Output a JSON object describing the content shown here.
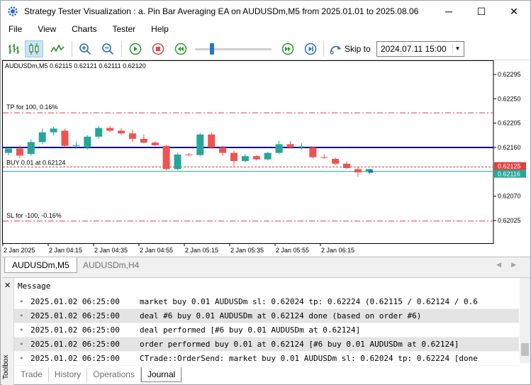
{
  "window": {
    "title": "Strategy Tester Visualization : a. Pin Bar Averaging EA on AUDUSDm,M5 from 2025.01.01 to 2025.08.06",
    "minimize_glyph": "─",
    "maximize_glyph": "☐",
    "close_glyph": "✕"
  },
  "menu": [
    "File",
    "View",
    "Charts",
    "Tester",
    "Help"
  ],
  "toolbar": {
    "skip_label": "Skip to",
    "skip_value": "2024.07.11 15:00",
    "slider_fraction": 0.22
  },
  "chart": {
    "info": "AUDUSDm,M5  0.62115 0.62121 0.62111 0.62120",
    "tp_label": "TP for 100, 0.16%",
    "buy_label": "BUY 0.01 at 0.62124",
    "sl_label": "SL for -100, -0.16%",
    "price_ticks": [
      "0.62295",
      "0.62250",
      "0.62205",
      "0.62160",
      "0.62070",
      "0.62025"
    ],
    "badge_red": "0.62125",
    "badge_green": "0.62116",
    "time_ticks": [
      "2 Jan 2025",
      "2 Jan 04:15",
      "2 Jan 04:35",
      "2 Jan 04:55",
      "2 Jan 05:15",
      "2 Jan 05:35",
      "2 Jan 05:55",
      "2 Jan 06:15"
    ],
    "colors": {
      "up": "#26a69a",
      "down": "#ef5350",
      "buy_line": "#00008b",
      "stop_line": "#e04040",
      "bid_line": "#26a69a"
    },
    "candles": [
      {
        "o": 0.6215,
        "h": 0.6216,
        "l": 0.62145,
        "c": 0.62158
      },
      {
        "o": 0.62158,
        "h": 0.62164,
        "l": 0.6214,
        "c": 0.62145
      },
      {
        "o": 0.62148,
        "h": 0.62175,
        "l": 0.62145,
        "c": 0.6217
      },
      {
        "o": 0.6217,
        "h": 0.62195,
        "l": 0.62166,
        "c": 0.62188
      },
      {
        "o": 0.62188,
        "h": 0.62198,
        "l": 0.62182,
        "c": 0.62195
      },
      {
        "o": 0.62191,
        "h": 0.62195,
        "l": 0.6216,
        "c": 0.62163
      },
      {
        "o": 0.62163,
        "h": 0.62171,
        "l": 0.62158,
        "c": 0.62164
      },
      {
        "o": 0.6216,
        "h": 0.62183,
        "l": 0.62156,
        "c": 0.6218
      },
      {
        "o": 0.6218,
        "h": 0.622,
        "l": 0.62176,
        "c": 0.62196
      },
      {
        "o": 0.62196,
        "h": 0.622,
        "l": 0.62188,
        "c": 0.62191
      },
      {
        "o": 0.62191,
        "h": 0.62196,
        "l": 0.62183,
        "c": 0.62186
      },
      {
        "o": 0.62186,
        "h": 0.62193,
        "l": 0.6217,
        "c": 0.62176
      },
      {
        "o": 0.62176,
        "h": 0.62184,
        "l": 0.62168,
        "c": 0.62169
      },
      {
        "o": 0.62169,
        "h": 0.62172,
        "l": 0.62163,
        "c": 0.62164
      },
      {
        "o": 0.62163,
        "h": 0.62165,
        "l": 0.62118,
        "c": 0.6212
      },
      {
        "o": 0.6212,
        "h": 0.6215,
        "l": 0.62118,
        "c": 0.62147
      },
      {
        "o": 0.62147,
        "h": 0.6215,
        "l": 0.62144,
        "c": 0.62146
      },
      {
        "o": 0.62146,
        "h": 0.62186,
        "l": 0.62144,
        "c": 0.62184
      },
      {
        "o": 0.62184,
        "h": 0.62188,
        "l": 0.62158,
        "c": 0.6216
      },
      {
        "o": 0.6216,
        "h": 0.62164,
        "l": 0.62144,
        "c": 0.6215
      },
      {
        "o": 0.6215,
        "h": 0.62154,
        "l": 0.62125,
        "c": 0.62135
      },
      {
        "o": 0.62135,
        "h": 0.62148,
        "l": 0.62132,
        "c": 0.62144
      },
      {
        "o": 0.62144,
        "h": 0.62146,
        "l": 0.62136,
        "c": 0.62138
      },
      {
        "o": 0.62138,
        "h": 0.62152,
        "l": 0.62136,
        "c": 0.6215
      },
      {
        "o": 0.6215,
        "h": 0.62172,
        "l": 0.62148,
        "c": 0.62166
      },
      {
        "o": 0.62166,
        "h": 0.62172,
        "l": 0.62158,
        "c": 0.6216
      },
      {
        "o": 0.6216,
        "h": 0.62168,
        "l": 0.62156,
        "c": 0.62162
      },
      {
        "o": 0.6216,
        "h": 0.62162,
        "l": 0.6214,
        "c": 0.62142
      },
      {
        "o": 0.62142,
        "h": 0.62148,
        "l": 0.62139,
        "c": 0.62141
      },
      {
        "o": 0.62139,
        "h": 0.62141,
        "l": 0.62128,
        "c": 0.6213
      },
      {
        "o": 0.6213,
        "h": 0.62134,
        "l": 0.6212,
        "c": 0.62122
      },
      {
        "o": 0.6212,
        "h": 0.62124,
        "l": 0.62106,
        "c": 0.62114
      },
      {
        "o": 0.62115,
        "h": 0.62121,
        "l": 0.62111,
        "c": 0.6212
      }
    ]
  },
  "chart_tabs": [
    "AUDUSDm,M5",
    "AUDUSDm,H4"
  ],
  "log": {
    "header": "Message",
    "rows": [
      {
        "time": "2025.01.02 06:25:00",
        "msg": "market buy 0.01 AUDUSDm sl: 0.62024 tp: 0.62224 (0.62115 / 0.62124 / 0.6"
      },
      {
        "time": "2025.01.02 06:25:00",
        "msg": "deal #6 buy 0.01 AUDUSDm at 0.62124 done (based on order #6)"
      },
      {
        "time": "2025.01.02 06:25:00",
        "msg": "deal performed [#6 buy 0.01 AUDUSDm at 0.62124]"
      },
      {
        "time": "2025.01.02 06:25:00",
        "msg": "order performed buy 0.01 at 0.62124 [#6 buy 0.01 AUDUSDm at 0.62124]"
      },
      {
        "time": "2025.01.02 06:25:00",
        "msg": "CTrade::OrderSend: market buy 0.01 AUDUSDm sl: 0.62024 tp: 0.62224 [done"
      }
    ]
  },
  "toolbox": {
    "label": "Toolbox",
    "close_glyph": "✕",
    "tabs": [
      "Trade",
      "History",
      "Operations",
      "Journal"
    ],
    "active_tab": "Journal"
  }
}
